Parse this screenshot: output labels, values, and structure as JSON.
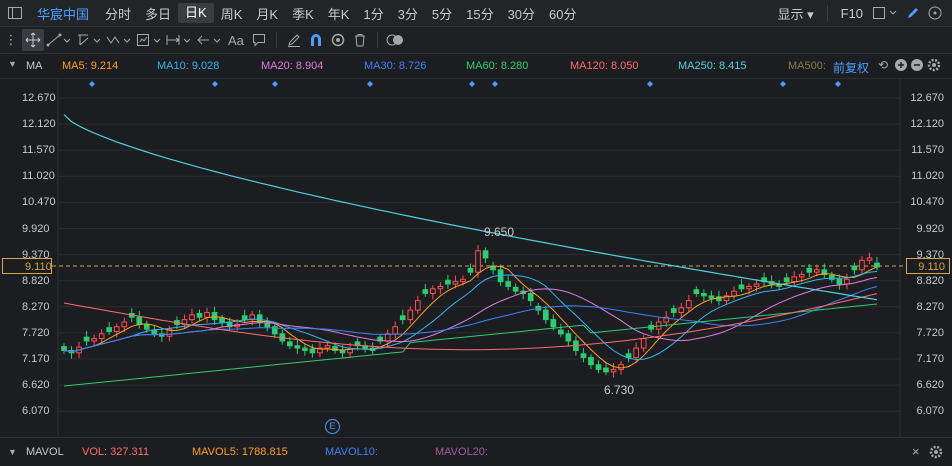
{
  "toolbar1": {
    "stock_name": "华宸中国",
    "periods": [
      "分时",
      "多日",
      "日K",
      "周K",
      "月K",
      "季K",
      "年K",
      "1分",
      "3分",
      "5分",
      "15分",
      "30分",
      "60分"
    ],
    "selected_period": "日K",
    "display_label": "显示",
    "f10_label": "F10"
  },
  "toolbar2": {
    "tools": [
      "crosshair-icon",
      "line-tool-icon",
      "channel-tool-icon",
      "wave-tool-icon",
      "measure-tool-icon",
      "range-tool-icon",
      "back-arrow-icon",
      "text-tool-icon",
      "comment-icon",
      "pen-icon",
      "magnet-icon",
      "eye-icon",
      "trash-icon",
      "toggle-icon"
    ],
    "text_tool_label": "Aa"
  },
  "ma_bar": {
    "label": "MA",
    "items": [
      {
        "name": "MA5: 9.214",
        "color": "#ff9f1c"
      },
      {
        "name": "MA10: 9.028",
        "color": "#29b6f6"
      },
      {
        "name": "MA20: 8.904",
        "color": "#e07be0"
      },
      {
        "name": "MA30: 8.726",
        "color": "#3b82f6"
      },
      {
        "name": "MA60: 8.280",
        "color": "#2ecc71"
      },
      {
        "name": "MA120: 8.050",
        "color": "#ff6b6b"
      },
      {
        "name": "MA250: 8.415",
        "color": "#4dd0e1"
      },
      {
        "name": "MA500:",
        "color": "#8a7a4a"
      }
    ],
    "adjust_label": "前复权"
  },
  "y_axis": [
    "12.670",
    "12.120",
    "11.570",
    "11.020",
    "10.470",
    "9.920",
    "9.370",
    "8.820",
    "8.270",
    "7.720",
    "7.170",
    "6.620",
    "6.070"
  ],
  "price_tag": "9.110",
  "annotations": {
    "high": "9.650",
    "low": "6.730"
  },
  "event_marker": "E",
  "bottom_bar": {
    "label": "MAVOL",
    "vol": "VOL: 327.311",
    "mavol5": "MAVOL5: 1788.815",
    "mavol10": "MAVOL10:",
    "mavol20": "MAVOL20:"
  },
  "colors": {
    "up": "#ff4d4f",
    "down": "#2ecc71",
    "ma250": "#4dd0e1",
    "price_line": "#d4a54a"
  }
}
